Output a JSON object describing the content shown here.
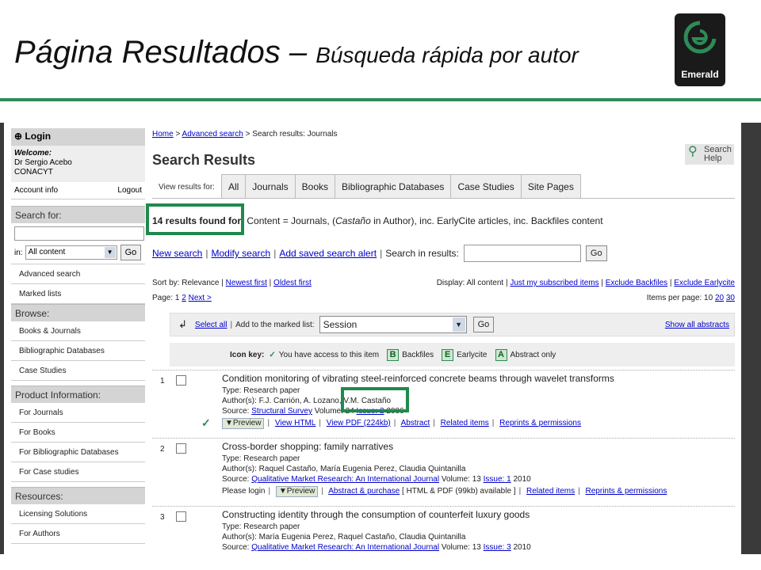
{
  "slide": {
    "title_main": "Página Resultados – ",
    "title_sub": "Búsqueda rápida por autor",
    "logo_text": "Emerald"
  },
  "sidebar": {
    "login_label": "Login",
    "welcome_label": "Welcome:",
    "user_name": "Dr Sergio Acebo",
    "user_org": "CONACYT",
    "account_info": "Account info",
    "logout": "Logout",
    "search_for": "Search for:",
    "in_label": "in:",
    "in_select": "All content",
    "go": "Go",
    "search_items": [
      "Advanced search",
      "Marked lists"
    ],
    "browse_head": "Browse:",
    "browse_items": [
      "Books & Journals",
      "Bibliographic Databases",
      "Case Studies"
    ],
    "product_head": "Product Information:",
    "product_items": [
      "For Journals",
      "For Books",
      "For Bibliographic Databases",
      "For Case studies"
    ],
    "resources_head": "Resources:",
    "resources_items": [
      "Licensing Solutions",
      "For Authors"
    ]
  },
  "main": {
    "crumb_home": "Home",
    "crumb_adv": "Advanced search",
    "crumb_current": "Search results: Journals",
    "title": "Search Results",
    "help": "Search Help",
    "view_label": "View results for:",
    "tabs": [
      "All",
      "Journals",
      "Books",
      "Bibliographic Databases",
      "Case Studies",
      "Site Pages"
    ],
    "results_count": "14 results found for:",
    "results_content": " Content = Journals, (",
    "results_author": "Castaño",
    "results_rest": " in Author), inc. EarlyCite articles, inc. Backfiles content",
    "new_search": "New search",
    "modify_search": "Modify search",
    "add_alert": "Add saved search alert",
    "search_in_results": "Search in results:",
    "go": "Go",
    "sort_label": "Sort by: Relevance",
    "newest": "Newest first",
    "oldest": "Oldest first",
    "display_label": "Display: All content",
    "just_subscribed": "Just my subscribed items",
    "exclude_backfiles": "Exclude Backfiles",
    "exclude_earlycite": "Exclude Earlycite",
    "page_label": "Page: 1",
    "page_2": "2",
    "next": "Next >",
    "per_page_label": "Items per page: 10",
    "per_20": "20",
    "per_30": "30",
    "select_all": "Select all",
    "add_marked": "Add to the marked list:",
    "session": "Session",
    "show_abstracts": "Show all abstracts",
    "icon_key": "Icon key:",
    "key_access": "You have access to this item",
    "key_b": "B",
    "key_backfiles": "Backfiles",
    "key_e": "E",
    "key_earlycite": "Earlycite",
    "key_a": "A",
    "key_abstract": "Abstract only"
  },
  "results": [
    {
      "num": "1",
      "title": "Condition monitoring of vibrating steel-reinforced concrete beams through wavelet transforms",
      "type": "Type: Research paper",
      "authors_prefix": "Author(s): F.J. Carrión, A. Lozano, ",
      "authors_hl": "V.M. Castaño",
      "source_prefix": "Source: ",
      "source_link": "Structural Survey",
      "source_vol": " Volume: 24 ",
      "issue_link": "Issue: 2",
      "source_year": " 2006",
      "preview": "▼Preview",
      "view_html": "View HTML",
      "view_pdf": "View PDF (224kb)",
      "abstract": "Abstract",
      "related": "Related items",
      "reprints": "Reprints & permissions"
    },
    {
      "num": "2",
      "title": "Cross-border shopping: family narratives",
      "type": "Type: Research paper",
      "authors": "Author(s): Raquel Castaño, María Eugenia Perez, Claudia Quintanilla",
      "source_prefix": "Source: ",
      "source_link": "Qualitative Market Research: An International Journal",
      "source_vol": " Volume: 13 ",
      "issue_link": "Issue: 1",
      "source_year": " 2010",
      "please_login": "Please login",
      "preview": "▼Preview",
      "abstract_purchase": "Abstract & purchase",
      "html_pdf": "[ HTML & PDF (99kb) available ]",
      "related": "Related items",
      "reprints": "Reprints & permissions"
    },
    {
      "num": "3",
      "title": "Constructing identity through the consumption of counterfeit luxury goods",
      "type": "Type: Research paper",
      "authors": "Author(s): María Eugenia Perez, Raquel Castaño, Claudia Quintanilla",
      "source_prefix": "Source: ",
      "source_link": "Qualitative Market Research: An International Journal",
      "source_vol": " Volume: 13 ",
      "issue_link": "Issue: 3",
      "source_year": " 2010"
    }
  ]
}
